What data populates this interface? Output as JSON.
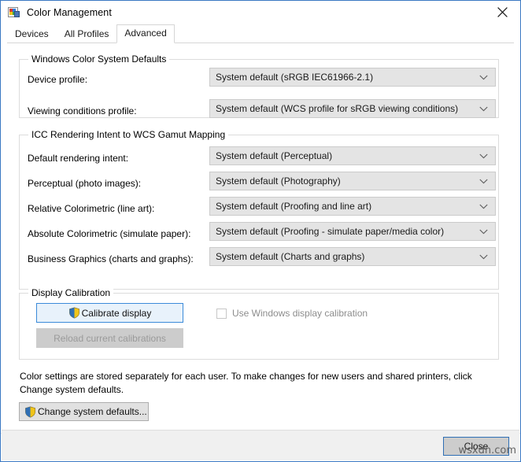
{
  "window": {
    "title": "Color Management",
    "icon": "color-management-icon",
    "close_icon": "close-icon"
  },
  "tabs": [
    {
      "label": "Devices",
      "active": false
    },
    {
      "label": "All Profiles",
      "active": false
    },
    {
      "label": "Advanced",
      "active": true
    }
  ],
  "groups": {
    "wcs_defaults": {
      "title": "Windows Color System Defaults",
      "fields": [
        {
          "label": "Device profile:",
          "value": "System default (sRGB IEC61966-2.1)"
        },
        {
          "label": "Viewing conditions profile:",
          "value": "System default (WCS profile for sRGB viewing conditions)"
        }
      ]
    },
    "icc_gamut": {
      "title": "ICC Rendering Intent to WCS Gamut Mapping",
      "fields": [
        {
          "label": "Default rendering intent:",
          "value": "System default (Perceptual)"
        },
        {
          "label": "Perceptual (photo images):",
          "value": "System default (Photography)"
        },
        {
          "label": "Relative Colorimetric (line art):",
          "value": "System default (Proofing and line art)"
        },
        {
          "label": "Absolute Colorimetric (simulate paper):",
          "value": "System default (Proofing - simulate paper/media color)"
        },
        {
          "label": "Business Graphics (charts and graphs):",
          "value": "System default (Charts and graphs)"
        }
      ]
    },
    "display_calibration": {
      "title": "Display Calibration",
      "calibrate_button": "Calibrate display",
      "reload_button": "Reload current calibrations",
      "use_windows_calibration_label": "Use Windows display calibration",
      "use_windows_calibration_checked": false
    }
  },
  "footer_note": "Color settings are stored separately for each user. To make changes for new users and shared printers, click Change system defaults.",
  "change_defaults_button": "Change system defaults...",
  "close_button": "Close",
  "watermark": "wsxdn.com",
  "colors": {
    "window_border": "#3b78c3",
    "accent_button_border": "#3b8ad9",
    "accent_button_fill": "#e8f2fb",
    "combo_fill": "#e4e4e4",
    "footer_fill": "#f0f0f0",
    "disabled_text": "#9a9a9a"
  }
}
